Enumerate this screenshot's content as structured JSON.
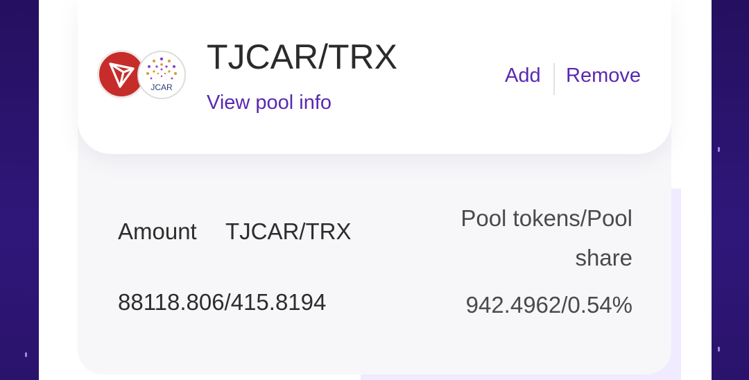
{
  "pool": {
    "pair_name": "TJCAR/TRX",
    "view_info_label": "View pool info",
    "add_label": "Add",
    "remove_label": "Remove",
    "token_a_icon": "tron-logo",
    "token_b_icon": "jcar-logo",
    "token_b_logo_text": "JCAR"
  },
  "details": {
    "amount_label": "Amount",
    "pair_label": "TJCAR/TRX",
    "pool_tokens_label": "Pool tokens/Pool share",
    "amount_value": "88118.806/415.8194",
    "pool_tokens_value": "942.4962/0.54%"
  },
  "colors": {
    "accent": "#5a28b0",
    "tron_red": "#c62d2a",
    "background_purple": "#2a1470"
  }
}
